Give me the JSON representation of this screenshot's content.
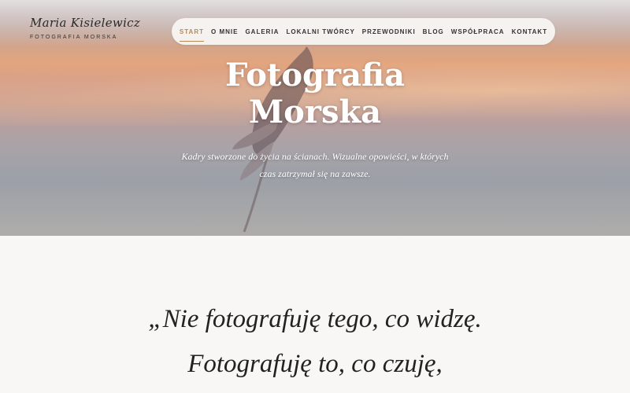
{
  "brand": {
    "name": "Maria Kisielewicz",
    "tagline": "FOTOGRAFIA MORSKA"
  },
  "nav": {
    "items": [
      {
        "label": "START",
        "active": true
      },
      {
        "label": "O MNIE"
      },
      {
        "label": "GALERIA"
      },
      {
        "label": "LOKALNI TWÓRCY"
      },
      {
        "label": "PRZEWODNIKI"
      },
      {
        "label": "BLOG"
      },
      {
        "label": "WSPÓŁPRACA"
      },
      {
        "label": "KONTAKT"
      }
    ]
  },
  "hero": {
    "title_line1": "Fotografia",
    "title_line2": "Morska",
    "subtitle": "Kadry stworzone do życia na ścianach. Wizualne opowieści, w których czas zatrzymał się na zawsze."
  },
  "quote": {
    "line1": "„Nie fotografuję tego, co widzę.",
    "line2": "Fotografuję to, co czuję,"
  },
  "colors": {
    "accent": "#b48a5a",
    "text": "#222222",
    "background": "#f8f7f5"
  }
}
